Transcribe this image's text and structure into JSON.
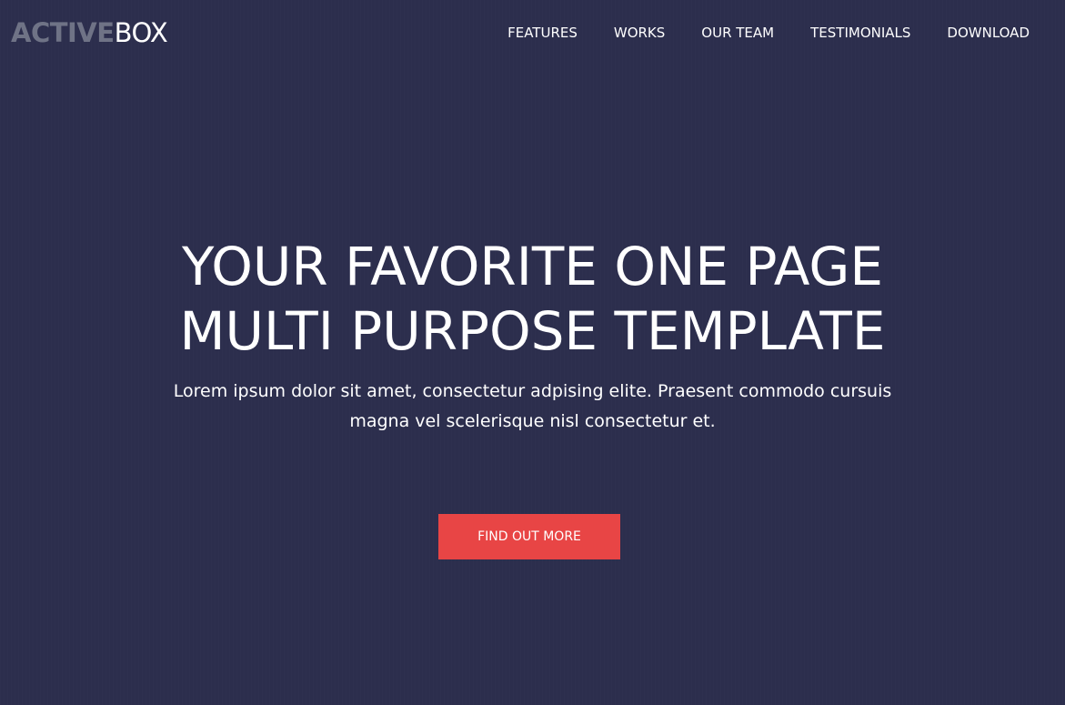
{
  "brand": {
    "bold": "ACTIVE",
    "light": "BOX"
  },
  "nav": {
    "items": [
      {
        "label": "FEATURES"
      },
      {
        "label": "WORKS"
      },
      {
        "label": "OUR TEAM"
      },
      {
        "label": "TESTIMONIALS"
      },
      {
        "label": "DOWNLOAD"
      }
    ]
  },
  "hero": {
    "title_line1": "YOUR FAVORITE ONE PAGE",
    "title_line2": "MULTI PURPOSE TEMPLATE",
    "subtitle": "Lorem ipsum dolor sit amet, consectetur adpising elite. Praesent commodo cursuis magna vel scelerisque nisl consectetur et.",
    "cta_label": "FIND OUT MORE"
  },
  "colors": {
    "background": "#2c2e4d",
    "accent": "#e84545",
    "logo_bold": "#6f7386",
    "text": "#ffffff"
  }
}
